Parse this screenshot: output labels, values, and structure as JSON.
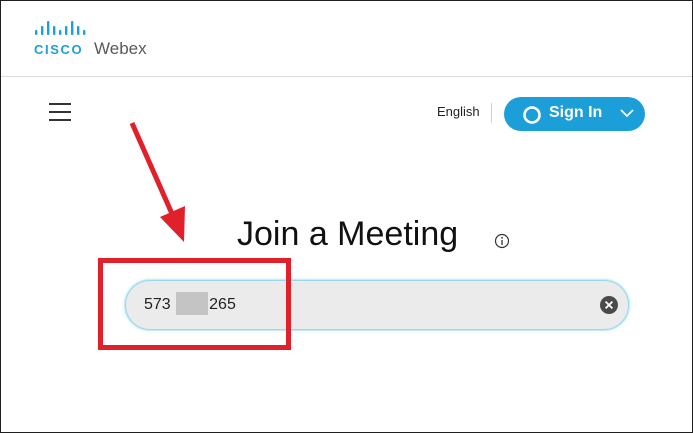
{
  "header": {
    "logo_cisco": "CISCO",
    "logo_webex": "Webex"
  },
  "nav": {
    "language": "English",
    "signin_label": "Sign In"
  },
  "main": {
    "title": "Join a Meeting",
    "meeting_input_value": "573 265"
  },
  "colors": {
    "brand_blue": "#1c9fd9",
    "annotation_red": "#e0202a"
  },
  "icons": [
    "menu-icon",
    "webex-swirl-icon",
    "chevron-down-icon",
    "info-icon",
    "clear-icon",
    "annotation-arrow"
  ]
}
